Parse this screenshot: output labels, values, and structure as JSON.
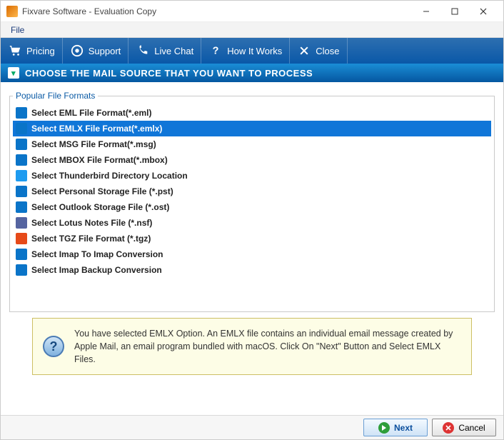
{
  "titlebar": {
    "title": "Fixvare Software - Evaluation Copy"
  },
  "menubar": {
    "file": "File"
  },
  "toolbar": {
    "pricing": "Pricing",
    "support": "Support",
    "livechat": "Live Chat",
    "howitworks": "How It Works",
    "close": "Close"
  },
  "section": {
    "header": "CHOOSE THE MAIL SOURCE THAT YOU WANT TO PROCESS"
  },
  "formats": {
    "legend": "Popular File Formats",
    "items": [
      "Select EML File Format(*.eml)",
      "Select EMLX File Format(*.emlx)",
      "Select MSG File Format(*.msg)",
      "Select MBOX File Format(*.mbox)",
      "Select Thunderbird Directory Location",
      "Select Personal Storage File (*.pst)",
      "Select Outlook Storage File (*.ost)",
      "Select Lotus Notes File (*.nsf)",
      "Select TGZ File Format (*.tgz)",
      "Select Imap To Imap Conversion",
      "Select Imap Backup Conversion"
    ],
    "selectedIndex": 1
  },
  "info": {
    "text": "You have selected EMLX Option. An EMLX file contains an individual email message created by Apple Mail, an email program bundled with macOS. Click On \"Next\" Button and Select EMLX Files."
  },
  "footer": {
    "next": "Next",
    "cancel": "Cancel"
  }
}
